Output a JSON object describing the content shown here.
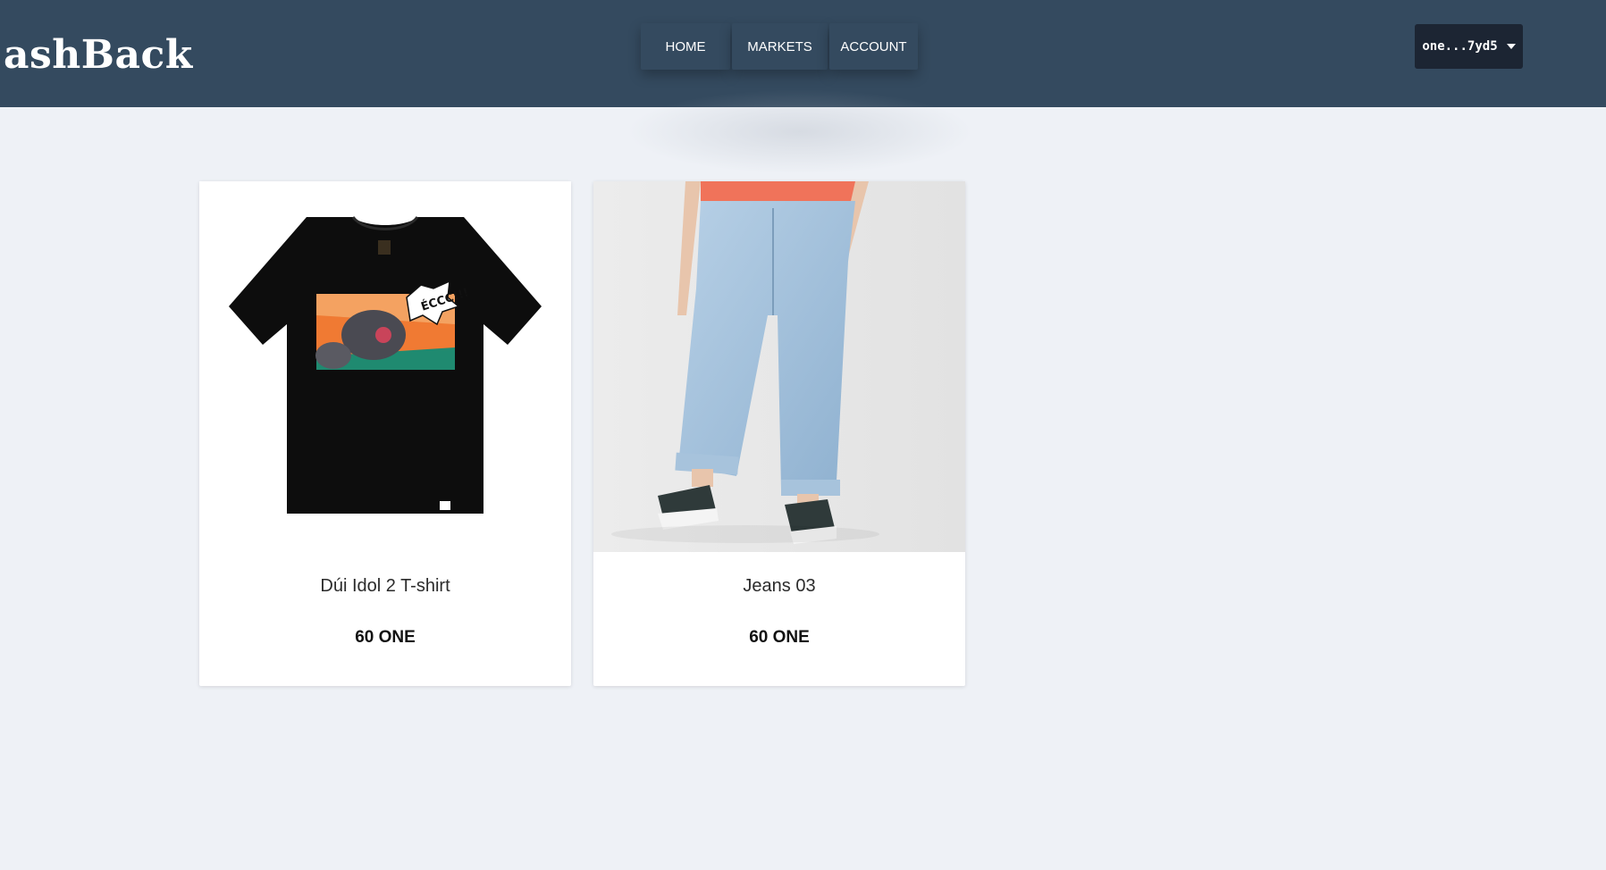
{
  "brand": {
    "logo_text": "ashBack",
    "logo_alt": "CashBack"
  },
  "nav": {
    "items": [
      {
        "label": "HOME"
      },
      {
        "label": "MARKETS"
      },
      {
        "label": "ACCOUNT"
      }
    ]
  },
  "wallet": {
    "address": "one...7yd5",
    "icon": "caret-down-icon"
  },
  "products": [
    {
      "name": "Dúi Idol 2 T-shirt",
      "price": "60 ONE",
      "image": "black-tshirt-image",
      "print_text": "ÉCCC!!!"
    },
    {
      "name": "Jeans 03",
      "price": "60 ONE",
      "image": "light-blue-jeans-image"
    }
  ],
  "colors": {
    "header": "#344a5f",
    "page_bg": "#eef1f6",
    "wallet_bg": "#1c2533",
    "logo_accent": "#2bb8a8"
  }
}
